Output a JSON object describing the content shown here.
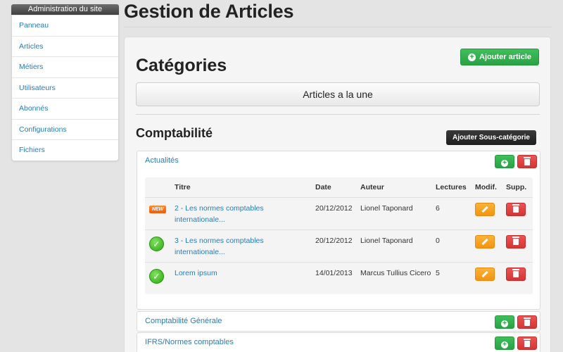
{
  "sidebar": {
    "header": "Administration du site",
    "items": [
      {
        "label": "Panneau"
      },
      {
        "label": "Articles"
      },
      {
        "label": "Métiers"
      },
      {
        "label": "Utilisateurs"
      },
      {
        "label": "Abonnés"
      },
      {
        "label": "Configurations"
      },
      {
        "label": "Fichiers"
      }
    ]
  },
  "page": {
    "title": "Gestion de Articles",
    "section_title": "Catégories",
    "add_article_label": "Ajouter article",
    "featured_label": "Articles a la une",
    "subsection_title": "Comptabilité",
    "add_subcategory_label": "Ajouter Sous-catégorie"
  },
  "categories": [
    {
      "name": "Actualités"
    },
    {
      "name": "Comptabilité Générale"
    },
    {
      "name": "IFRS/Normes comptables"
    }
  ],
  "table": {
    "headers": {
      "title": "Titre",
      "date": "Date",
      "author": "Auteur",
      "reads": "Lectures",
      "edit": "Modif.",
      "delete": "Supp."
    },
    "rows": [
      {
        "status": "new-badge-icon",
        "status_text": "NEW",
        "title": "2 - Les normes comptables internationale...",
        "date": "20/12/2012",
        "author": "Lionel Taponard",
        "reads": "6"
      },
      {
        "status": "check-icon",
        "title": "3 - Les normes comptables internationale...",
        "date": "20/12/2012",
        "author": "Lionel Taponard",
        "reads": "0"
      },
      {
        "status": "check-icon",
        "title": "Lorem ipsum",
        "date": "14/01/2013",
        "author": "Marcus Tullius Cicero",
        "reads": "5"
      }
    ]
  },
  "colors": {
    "accent_link": "#2a7cb8",
    "green": "#2aa147",
    "red": "#d43535",
    "orange": "#f39311",
    "dark_button": "#1f1f1f"
  }
}
